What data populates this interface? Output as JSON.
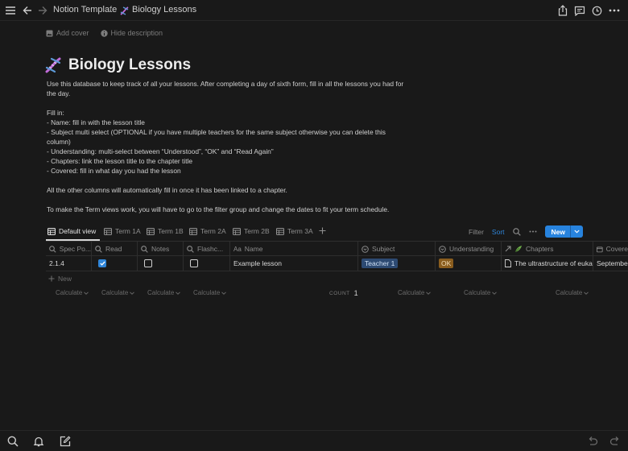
{
  "breadcrumb": {
    "workspace": "Notion Template",
    "separator": "/",
    "page": "Biology Lessons"
  },
  "page_actions": {
    "add_cover": "Add cover",
    "hide_description": "Hide description"
  },
  "page": {
    "title": "Biology Lessons",
    "icon": "dna-icon",
    "description": [
      "Use this database to keep track of all your lessons. After completing a day of sixth form, fill in all the lessons you had for the day.",
      "",
      "Fill in:",
      "- Name: fill in with the lesson title",
      "- Subject multi select (OPTIONAL if you have multiple teachers for the same subject otherwise you can delete this column)",
      "- Understanding: multi-select between “Understood”, “OK” and “Read Again”",
      "- Chapters: link the lesson title to the chapter title",
      "- Covered: fill in what day you had the lesson",
      "",
      "All the other columns will automatically fill in once it has been linked to a chapter.",
      "",
      "To make the Term views work, you will have to go to the filter group and change the dates to fit your term schedule."
    ]
  },
  "views": {
    "tabs": [
      "Default view",
      "Term 1A",
      "Term 1B",
      "Term 2A",
      "Term 2B",
      "Term 3A"
    ],
    "active": "Default view",
    "filter": "Filter",
    "sort": "Sort",
    "new": "New"
  },
  "table": {
    "columns": [
      "Spec Po...",
      "Read",
      "Notes",
      "Flashc...",
      "Name",
      "Subject",
      "Understanding",
      "Chapters",
      "Covere"
    ],
    "rows": [
      {
        "spec_point": "2.1.4",
        "read": true,
        "notes": false,
        "flashcards": false,
        "name": "Example lesson",
        "subject": "Teacher 1",
        "understanding": "OK",
        "chapters": "The ultrastructure of euka",
        "covered": "September"
      }
    ],
    "add_row": "New",
    "footer": {
      "calculate": "Calculate",
      "count_label": "COUNT",
      "count_value": "1"
    }
  },
  "colors": {
    "background": "#191919",
    "accent": "#2783de",
    "subject_tag": "#2d4a72",
    "ok_tag": "#8a5d1e"
  }
}
